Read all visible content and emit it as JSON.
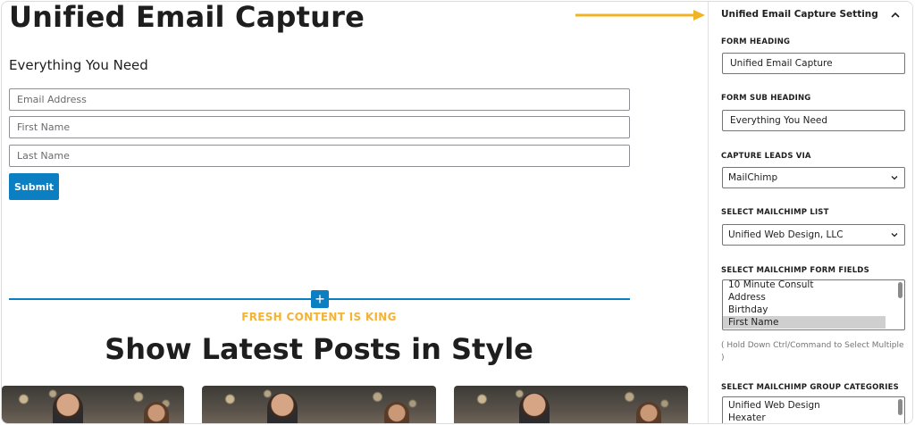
{
  "editor": {
    "form_heading": "Unified Email Capture",
    "form_subheading": "Everything You Need",
    "fields": [
      {
        "placeholder": "Email Address"
      },
      {
        "placeholder": "First Name"
      },
      {
        "placeholder": "Last Name"
      }
    ],
    "submit_label": "Submit",
    "inserter_symbol": "+",
    "kicker": "FRESH CONTENT IS KING",
    "posts_title": "Show Latest Posts in Style",
    "accent_color": "#0b7fc2",
    "kicker_color": "#f5b335",
    "arrow_color": "#f0b323"
  },
  "sidebar": {
    "panel_title": "Unified Email Capture Setting",
    "toggle_icon": "chevron-up-icon",
    "form_heading_label": "FORM HEADING",
    "form_heading_value": "Unified Email Capture",
    "form_subheading_label": "FORM SUB HEADING",
    "form_subheading_value": "Everything You Need",
    "capture_label": "CAPTURE LEADS VIA",
    "capture_value": "MailChimp",
    "list_label": "SELECT MAILCHIMP LIST",
    "list_value": "Unified Web Design, LLC",
    "fields_label": "SELECT MAILCHIMP FORM FIELDS",
    "form_field_options": [
      "10 Minute Consult",
      "Address",
      "Birthday",
      "First Name"
    ],
    "form_field_selected": "First Name",
    "help_text": "( Hold Down Ctrl/Command to Select Multiple )",
    "group_label": "SELECT MAILCHIMP GROUP CATEGORIES",
    "group_options": [
      "Unified Web Design",
      "Hexater"
    ]
  }
}
